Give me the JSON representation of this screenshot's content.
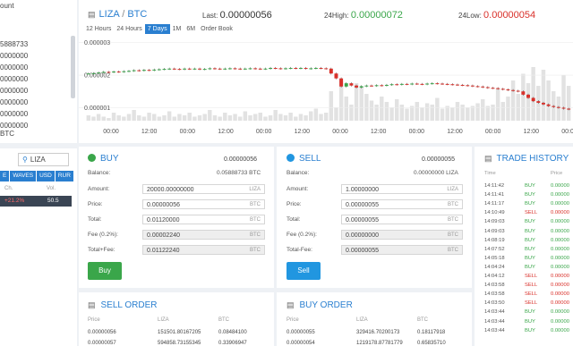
{
  "sidebar": {
    "balance_label": "ount",
    "balances": [
      "5888733",
      "0000000",
      "0000000",
      "0000000",
      "0000000",
      "0000000",
      "0000000",
      "0000000"
    ],
    "btc_label": "BTC",
    "search_value": "LIZA",
    "tabs": [
      "E",
      "WAVES",
      "USD",
      "RUR"
    ],
    "headers": {
      "change": "Ch.",
      "volume": "Vol."
    },
    "row": {
      "change": "+21.2%",
      "volume": "50.5"
    }
  },
  "header": {
    "base": "LIZA",
    "quote": "BTC",
    "last_label": "Last:",
    "last_value": "0.00000056",
    "high_label": "24High:",
    "high_value": "0.00000072",
    "low_label": "24Low:",
    "low_value": "0.00000054"
  },
  "ranges": [
    "12 Hours",
    "24 Hours",
    "7 Days",
    "1M",
    "6M",
    "Order Book"
  ],
  "active_range": "7 Days",
  "chart_data": {
    "type": "candlestick",
    "y_ticks": [
      "0.000003",
      "0.000002",
      "0.000001"
    ],
    "x_ticks": [
      "00:00",
      "12:00",
      "00:00",
      "12:00",
      "00:00",
      "12:00",
      "00:00",
      "12:00",
      "00:00",
      "12:00",
      "00:00",
      "12:00",
      "00:00"
    ],
    "close": [
      2.05e-06,
      2.06e-06,
      2.08e-06,
      2.1e-06,
      2.09e-06,
      2.11e-06,
      2.1e-06,
      2.12e-06,
      2.13e-06,
      2.15e-06,
      2.14e-06,
      2.16e-06,
      2.15e-06,
      2.17e-06,
      2.18e-06,
      2.19e-06,
      2.2e-06,
      2.19e-06,
      2.18e-06,
      2.2e-06,
      2.19e-06,
      2.2e-06,
      2.18e-06,
      2.19e-06,
      2.21e-06,
      2.2e-06,
      2.19e-06,
      2.2e-06,
      2.21e-06,
      2.2e-06,
      2.19e-06,
      2.2e-06,
      2.21e-06,
      2.2e-06,
      2.19e-06,
      2.2e-06,
      2.22e-06,
      2.21e-06,
      2.2e-06,
      2.21e-06,
      2.22e-06,
      2.21e-06,
      2.22e-06,
      2.2e-06,
      2.21e-06,
      2.22e-06,
      2.21e-06,
      2.2e-06,
      2.05e-06,
      1.9e-06,
      1.65e-06,
      1.75e-06,
      1.68e-06,
      1.62e-06,
      1.66e-06,
      1.68e-06,
      1.67e-06,
      1.69e-06,
      1.68e-06,
      1.7e-06,
      1.72e-06,
      1.71e-06,
      1.73e-06,
      1.72e-06,
      1.74e-06,
      1.73e-06,
      1.72e-06,
      1.74e-06,
      1.75e-06,
      1.74e-06,
      1.73e-06,
      1.72e-06,
      1.71e-06,
      1.7e-06,
      1.69e-06,
      1.68e-06,
      1.66e-06,
      1.65e-06,
      1.63e-06,
      1.61e-06,
      1.6e-06,
      1.58e-06,
      1.56e-06,
      1.54e-06,
      1.52e-06,
      1.5e-06,
      1.4e-06,
      1.3e-06,
      1.2e-06,
      1.15e-06,
      1.1e-06,
      1.05e-06,
      1.02e-06,
      1e-06,
      9.7e-07,
      9.5e-07
    ],
    "volume": [
      4,
      3,
      5,
      3,
      2,
      6,
      4,
      3,
      5,
      8,
      4,
      3,
      6,
      5,
      3,
      4,
      7,
      3,
      5,
      4,
      6,
      3,
      4,
      5,
      8,
      4,
      3,
      6,
      4,
      5,
      3,
      7,
      4,
      5,
      6,
      3,
      4,
      8,
      5,
      4,
      6,
      3,
      5,
      4,
      7,
      9,
      5,
      6,
      22,
      10,
      30,
      18,
      12,
      28,
      25,
      20,
      15,
      12,
      18,
      14,
      10,
      16,
      12,
      9,
      11,
      14,
      10,
      13,
      12,
      17,
      9,
      11,
      10,
      14,
      12,
      10,
      11,
      13,
      16,
      11,
      12,
      24,
      14,
      18,
      30,
      20,
      35,
      28,
      40,
      26,
      38,
      30,
      22,
      18,
      34,
      26
    ]
  },
  "buy": {
    "title": "BUY",
    "header_value": "0.00000056",
    "balance_label": "Balance:",
    "balance_value": "0.05888733 BTC",
    "amount_label": "Amount:",
    "amount_value": "20000.00000000",
    "amount_unit": "LIZA",
    "price_label": "Price:",
    "price_value": "0.00000056",
    "price_unit": "BTC",
    "total_label": "Total:",
    "total_value": "0.01120000",
    "total_unit": "BTC",
    "fee_label": "Fee (0.2%):",
    "fee_value": "0.00002240",
    "fee_unit": "BTC",
    "totalfee_label": "Total+Fee:",
    "totalfee_value": "0.01122240",
    "totalfee_unit": "BTC",
    "button": "Buy"
  },
  "sell": {
    "title": "SELL",
    "header_value": "0.00000055",
    "balance_label": "Balance:",
    "balance_value": "0.00000000 LIZA",
    "amount_label": "Amount:",
    "amount_value": "1.00000000",
    "amount_unit": "LIZA",
    "price_label": "Price:",
    "price_value": "0.00000055",
    "price_unit": "BTC",
    "total_label": "Total:",
    "total_value": "0.00000055",
    "total_unit": "BTC",
    "fee_label": "Fee (0.2%):",
    "fee_value": "0.00000000",
    "fee_unit": "BTC",
    "totalfee_label": "Total-Fee:",
    "totalfee_value": "0.00000055",
    "totalfee_unit": "BTC",
    "button": "Sell"
  },
  "trade_history": {
    "title": "TRADE HISTORY",
    "headers": [
      "Time",
      "Price"
    ],
    "rows": [
      {
        "time": "14:11:42",
        "type": "BUY",
        "price": "0.00000"
      },
      {
        "time": "14:11:41",
        "type": "BUY",
        "price": "0.00000"
      },
      {
        "time": "14:11:17",
        "type": "BUY",
        "price": "0.00000"
      },
      {
        "time": "14:10:49",
        "type": "SELL",
        "price": "0.00000"
      },
      {
        "time": "14:09:03",
        "type": "BUY",
        "price": "0.00000"
      },
      {
        "time": "14:09:03",
        "type": "BUY",
        "price": "0.00000"
      },
      {
        "time": "14:08:19",
        "type": "BUY",
        "price": "0.00000"
      },
      {
        "time": "14:07:52",
        "type": "BUY",
        "price": "0.00000"
      },
      {
        "time": "14:05:18",
        "type": "BUY",
        "price": "0.00000"
      },
      {
        "time": "14:04:24",
        "type": "BUY",
        "price": "0.00000"
      },
      {
        "time": "14:04:12",
        "type": "SELL",
        "price": "0.00000"
      },
      {
        "time": "14:03:58",
        "type": "SELL",
        "price": "0.00000"
      },
      {
        "time": "14:03:58",
        "type": "SELL",
        "price": "0.00000"
      },
      {
        "time": "14:03:50",
        "type": "SELL",
        "price": "0.00000"
      },
      {
        "time": "14:03:44",
        "type": "BUY",
        "price": "0.00000"
      },
      {
        "time": "14:03:44",
        "type": "BUY",
        "price": "0.00000"
      },
      {
        "time": "14:03:44",
        "type": "BUY",
        "price": "0.00000"
      }
    ]
  },
  "sell_order": {
    "title": "SELL ORDER",
    "headers": [
      "Price",
      "LIZA",
      "BTC"
    ],
    "rows": [
      [
        "0.00000056",
        "151501.80167205",
        "0.08484100"
      ],
      [
        "0.00000057",
        "594858.73155345",
        "0.33906947"
      ]
    ]
  },
  "buy_order": {
    "title": "BUY ORDER",
    "headers": [
      "Price",
      "LIZA",
      "BTC"
    ],
    "rows": [
      [
        "0.00000055",
        "329416.70200173",
        "0.18117918"
      ],
      [
        "0.00000054",
        "1219178.87781779",
        "0.65835710"
      ]
    ]
  },
  "colors": {
    "accent": "#2a7fd0",
    "up": "#3aa64a",
    "down": "#d9302a",
    "buy_button": "#3aa64a",
    "sell_button": "#2196e0"
  }
}
